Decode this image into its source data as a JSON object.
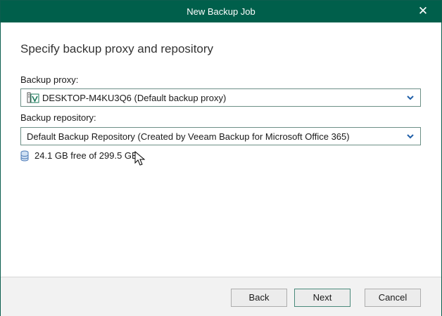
{
  "window": {
    "title": "New Backup Job",
    "close_glyph": "✕"
  },
  "page": {
    "heading": "Specify backup proxy and repository"
  },
  "proxy": {
    "label": "Backup proxy:",
    "selected": "DESKTOP-M4KU3Q6 (Default backup proxy)",
    "icon": "server-proxy-icon"
  },
  "repository": {
    "label": "Backup repository:",
    "selected": "Default Backup Repository (Created by Veeam Backup for Microsoft Office 365)",
    "free_space": "24.1 GB free of 299.5 GB",
    "icon": "database-icon"
  },
  "buttons": {
    "back": "Back",
    "next": "Next",
    "cancel": "Cancel"
  },
  "colors": {
    "titlebar": "#005f4b",
    "chevron": "#1f5fa8",
    "storage_icon": "#4a78b5"
  }
}
